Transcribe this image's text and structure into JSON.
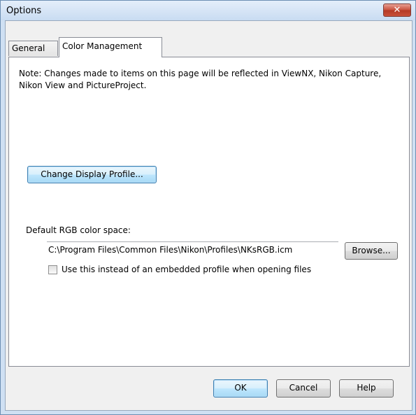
{
  "window": {
    "title": "Options",
    "close_label": "✕"
  },
  "tabs": [
    {
      "label": "General",
      "selected": false
    },
    {
      "label": "Color Management",
      "selected": true
    }
  ],
  "panel": {
    "note": "Note: Changes made to items on this page will be reflected in ViewNX, Nikon Capture, Nikon View and PictureProject.",
    "change_display_profile_label": "Change Display Profile...",
    "default_rgb_label": "Default RGB color space:",
    "rgb_path_value": "C:\\Program Files\\Common Files\\Nikon\\Profiles\\NKsRGB.icm",
    "browse_label": "Browse...",
    "use_instead_label": "Use this instead of an embedded profile when opening files",
    "use_instead_checked": false
  },
  "footer": {
    "ok_label": "OK",
    "cancel_label": "Cancel",
    "help_label": "Help"
  },
  "colors": {
    "close_button": "#c9523f",
    "title_bar": "#c9dcf2",
    "focus_border": "#3c7fb1"
  }
}
